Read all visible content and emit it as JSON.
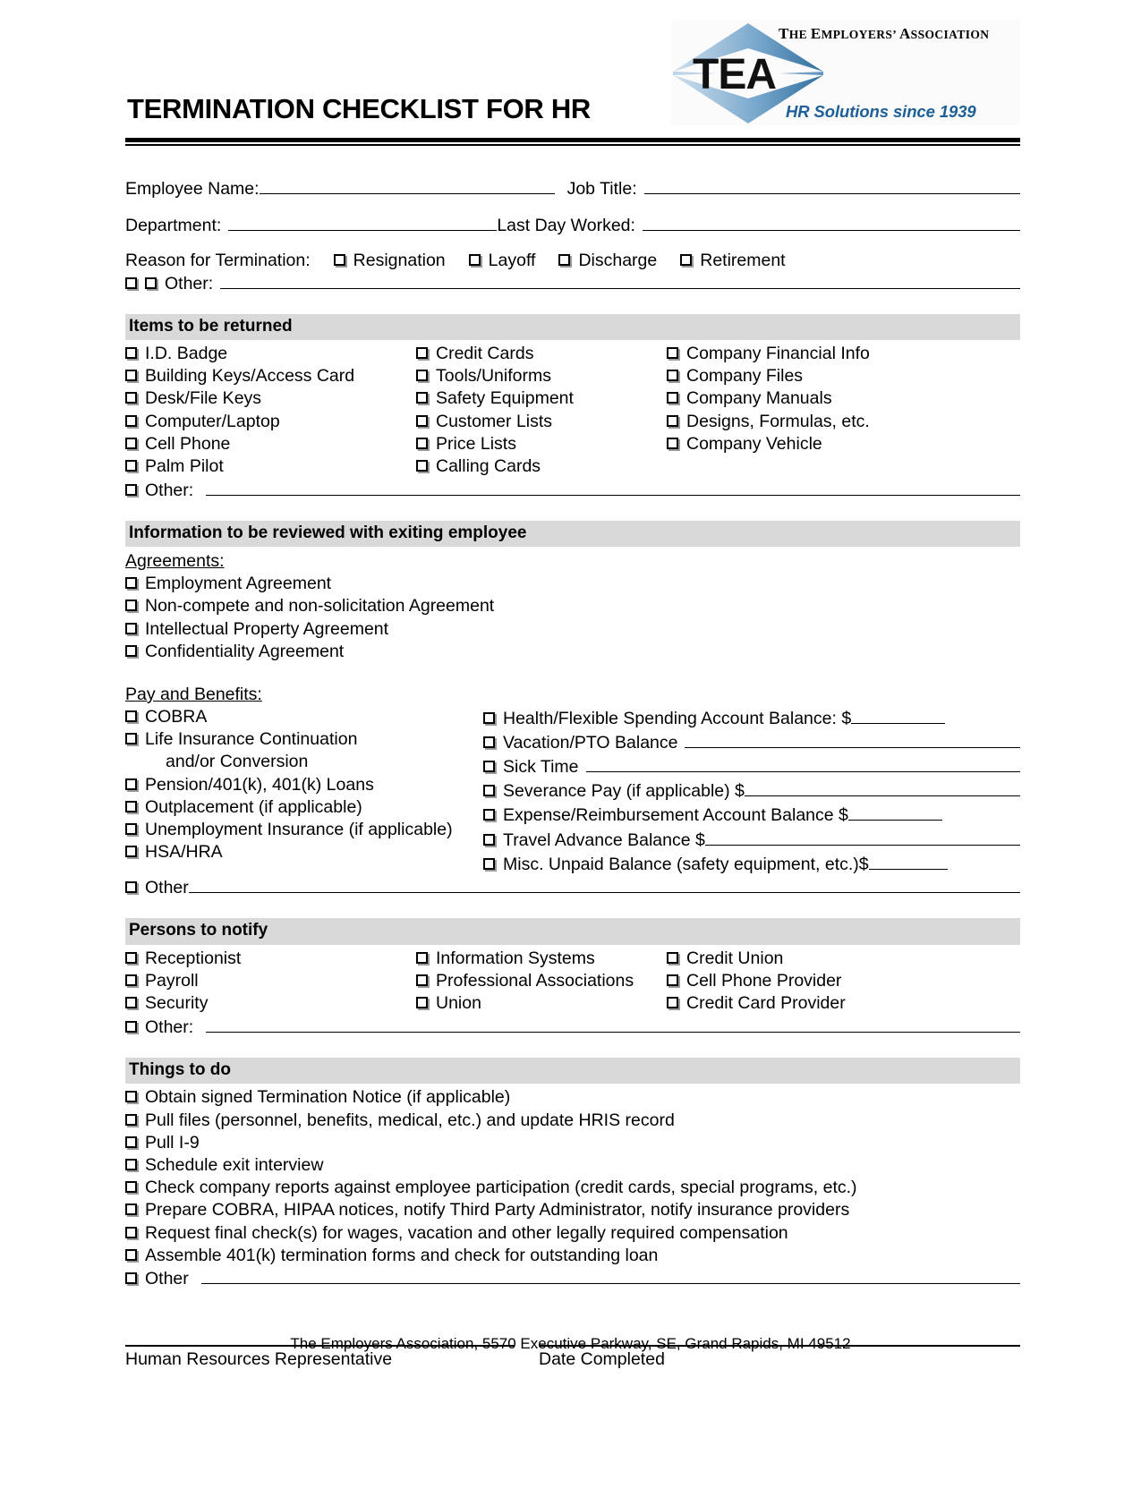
{
  "header": {
    "title": "TERMINATION CHECKLIST FOR HR",
    "logo": {
      "mark_text": "TEA",
      "org_name_the": "T",
      "org_name": "THE EMPLOYERS' ASSOCIATION",
      "org_name_parts": [
        "T",
        "HE ",
        "E",
        "MPLOYERS' ",
        "A",
        "SSOCIATION"
      ],
      "tagline": "HR Solutions since 1939",
      "tagline_color": "#1d5f96",
      "diamond_color": "#6f9fc8"
    }
  },
  "fields": {
    "employee_name_label": "Employee Name:",
    "employee_name_value": "",
    "job_title_label": "Job Title:",
    "job_title_value": "",
    "department_label": "Department:",
    "department_value": "",
    "last_day_worked_label": "Last Day Worked:",
    "last_day_worked_value": "",
    "reason_label": "Reason for Termination:",
    "reason_options": [
      "Resignation",
      "Layoff",
      "Discharge",
      "Retirement"
    ],
    "reason_other_label": "Other:",
    "reason_other_value": ""
  },
  "sections": {
    "items_returned": {
      "heading": "Items to be returned",
      "col1": [
        "I.D. Badge",
        "Building Keys/Access Card",
        "Desk/File Keys",
        "Computer/Laptop",
        "Cell Phone",
        "Palm Pilot"
      ],
      "col2": [
        "Credit Cards",
        "Tools/Uniforms",
        "Safety Equipment",
        "Customer Lists",
        "Price Lists",
        "Calling Cards"
      ],
      "col3": [
        "Company Financial Info",
        "Company Files",
        "Company Manuals",
        "Designs, Formulas, etc.",
        "Company Vehicle"
      ],
      "other_label": "Other:",
      "other_value": ""
    },
    "information_reviewed": {
      "heading": "Information to be reviewed with exiting employee",
      "agreements_subhead": "Agreements:",
      "agreements": [
        "Employment Agreement",
        "Non-compete and non-solicitation Agreement",
        "Intellectual Property Agreement",
        "Confidentiality Agreement"
      ],
      "pay_subhead": "Pay and Benefits:",
      "pay_left": [
        "COBRA",
        "Life Insurance Continuation",
        "Pension/401(k), 401(k) Loans",
        "Outplacement (if applicable)",
        "Unemployment Insurance  (if applicable)",
        "HSA/HRA"
      ],
      "pay_left_continuation": "and/or Conversion",
      "pay_left_other_label": "Other",
      "pay_left_other_value": "",
      "pay_right": [
        "Health/Flexible Spending Account Balance: $",
        "Vacation/PTO Balance",
        "Sick Time",
        "Severance Pay (if applicable) $",
        "Expense/Reimbursement Account Balance $",
        "Travel Advance Balance $",
        "Misc. Unpaid Balance (safety equipment, etc.)$"
      ]
    },
    "persons_to_notify": {
      "heading": "Persons to notify",
      "col1": [
        "Receptionist",
        "Payroll",
        "Security"
      ],
      "col2": [
        "Information Systems",
        "Professional Associations",
        "Union"
      ],
      "col3": [
        "Credit Union",
        "Cell Phone Provider",
        "Credit Card Provider"
      ],
      "other_label": "Other:",
      "other_value": ""
    },
    "things_to_do": {
      "heading": "Things to do",
      "items": [
        "Obtain signed Termination Notice (if applicable)",
        "Pull files (personnel, benefits, medical, etc.) and update HRIS record",
        "Pull I-9",
        "Schedule exit interview",
        "Check company reports against employee participation (credit cards, special programs, etc.)",
        "Prepare COBRA, HIPAA notices, notify Third Party Administrator, notify insurance providers",
        "Request final check(s) for wages, vacation and other legally required compensation",
        "Assemble 401(k) termination forms and check for outstanding loan"
      ],
      "other_label": "Other",
      "other_value": ""
    }
  },
  "signature": {
    "hr_rep_label": "Human Resources Representative",
    "hr_rep_value": "",
    "date_completed_label": "Date Completed",
    "date_completed_value": ""
  },
  "footer": {
    "text": "The Employers Association, 5570 Executive Parkway, SE, Grand Rapids, MI  49512"
  }
}
